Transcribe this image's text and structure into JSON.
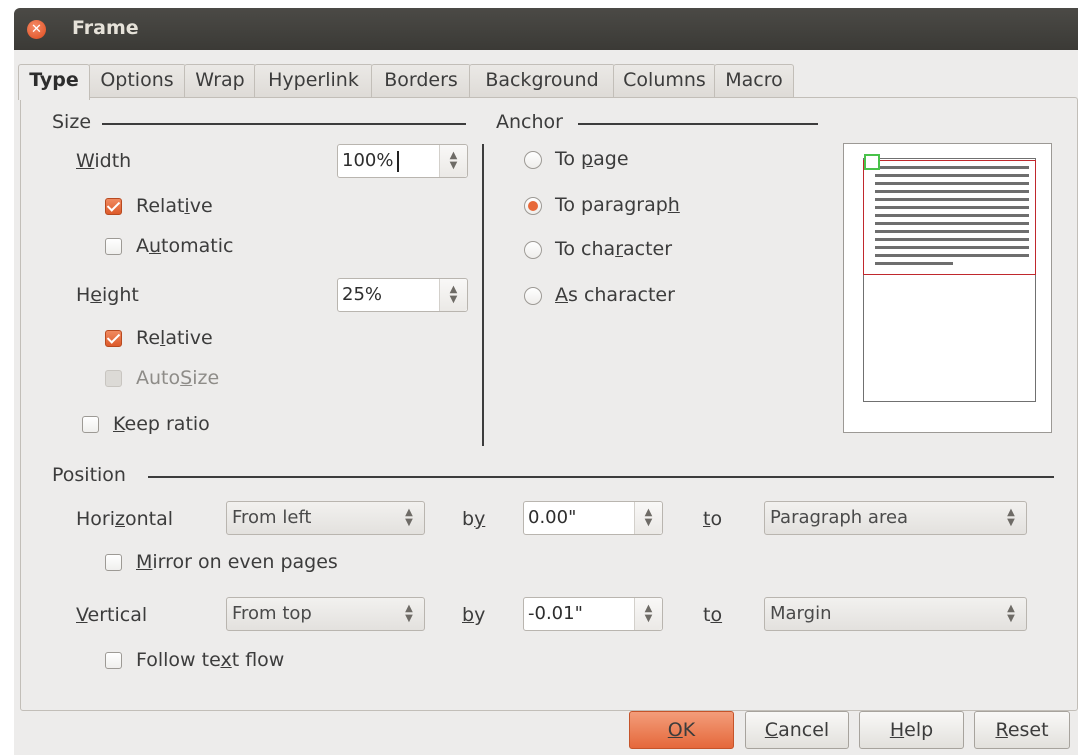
{
  "window": {
    "title": "Frame"
  },
  "tabs": [
    {
      "label": "Type",
      "active": true
    },
    {
      "label": "Options"
    },
    {
      "label": "Wrap"
    },
    {
      "label": "Hyperlink"
    },
    {
      "label": "Borders"
    },
    {
      "label": "Background"
    },
    {
      "label": "Columns"
    },
    {
      "label": "Macro"
    }
  ],
  "size": {
    "title": "Size",
    "width_label": "Width",
    "width_value": "100%",
    "width_relative_label": "Relative",
    "width_relative_checked": true,
    "automatic_label": "Automatic",
    "automatic_checked": false,
    "height_label": "Height",
    "height_value": "25%",
    "height_relative_label": "Relative",
    "height_relative_checked": true,
    "autosize_label": "AutoSize",
    "autosize_checked": false,
    "keep_ratio_label": "Keep ratio",
    "keep_ratio_checked": false
  },
  "anchor": {
    "title": "Anchor",
    "options": [
      {
        "label": "To page",
        "checked": false
      },
      {
        "label": "To paragraph",
        "checked": true
      },
      {
        "label": "To character",
        "checked": false
      },
      {
        "label": "As character",
        "checked": false
      }
    ]
  },
  "position": {
    "title": "Position",
    "horizontal_label": "Horizontal",
    "horizontal_select": "From left",
    "by_label": "by",
    "horizontal_by": "0.00\"",
    "to_label": "to",
    "horizontal_to": "Paragraph area",
    "mirror_label": "Mirror on even pages",
    "mirror_checked": false,
    "vertical_label": "Vertical",
    "vertical_select": "From top",
    "vertical_by": "-0.01\"",
    "vertical_to": "Margin",
    "follow_label": "Follow text flow",
    "follow_checked": false
  },
  "buttons": {
    "ok": "OK",
    "cancel": "Cancel",
    "help": "Help",
    "reset": "Reset"
  },
  "colors": {
    "accent": "#e5683b",
    "titlebar": "#3b3a36",
    "preview_frame": "#c0282d",
    "preview_anchor": "#49c24a"
  }
}
